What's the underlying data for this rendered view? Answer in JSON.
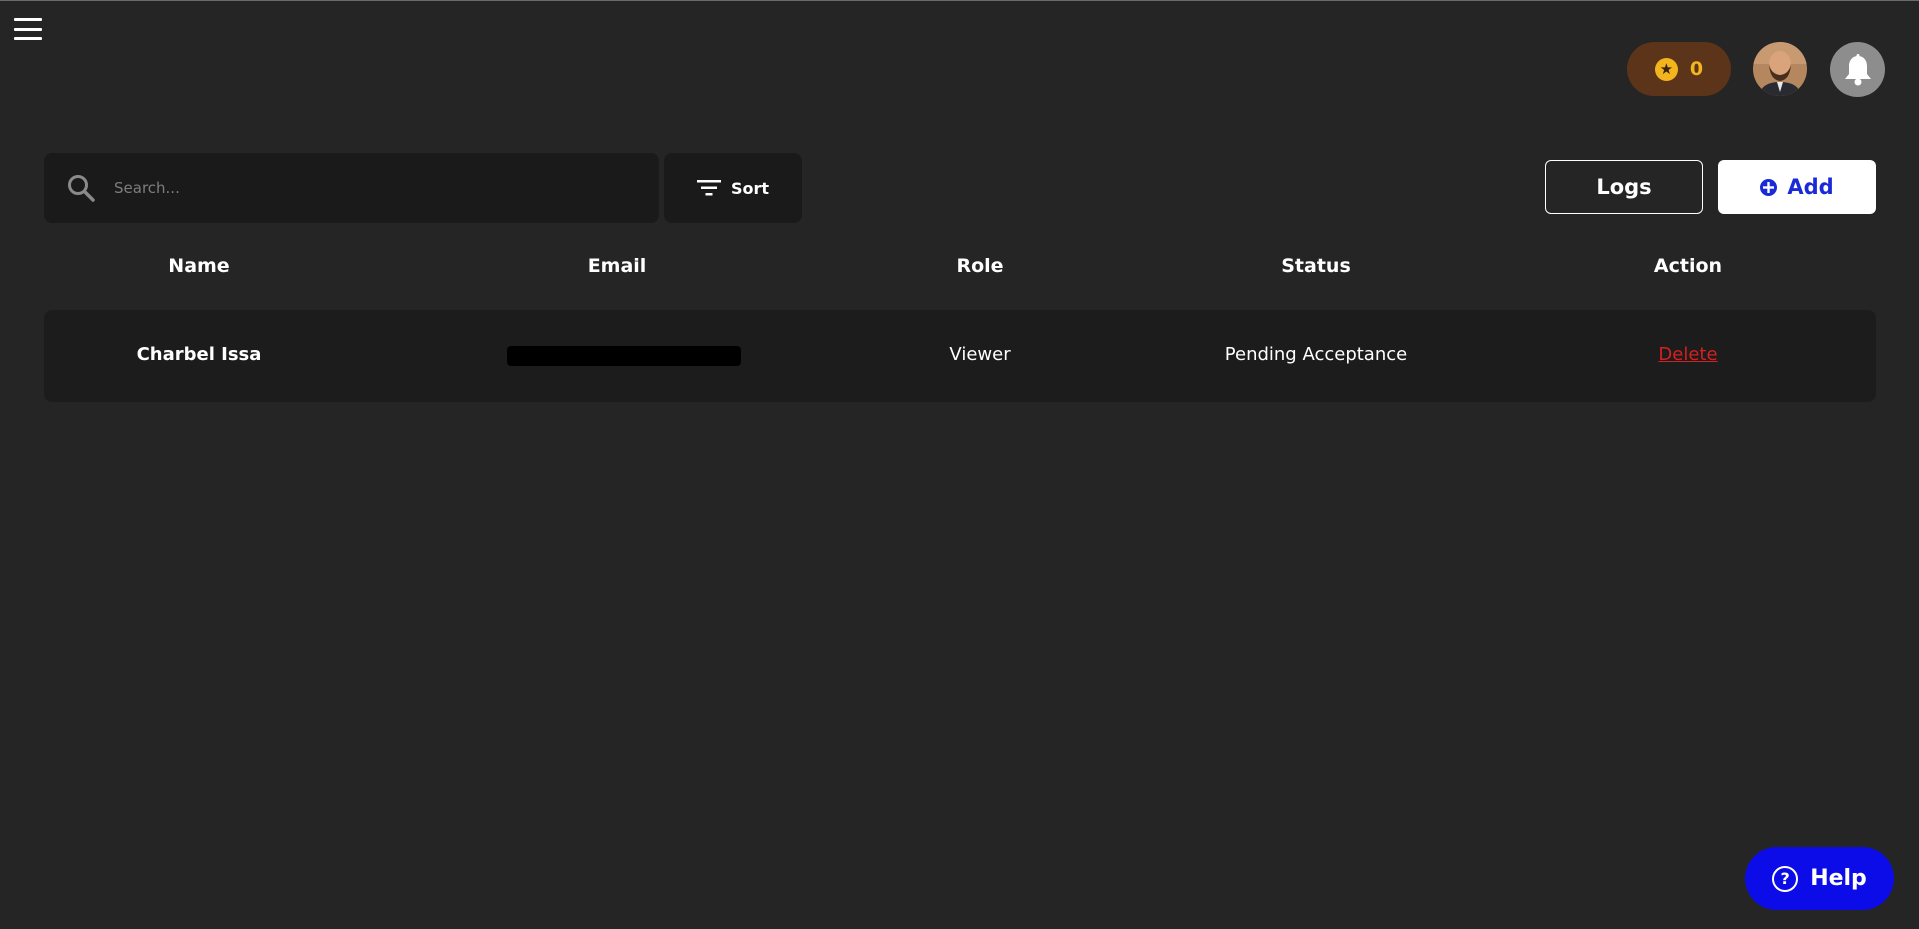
{
  "header": {
    "coins": {
      "count": "0",
      "icon": "star-coin-icon"
    },
    "avatar": {
      "icon": "user-avatar"
    },
    "notifications": {
      "icon": "bell-icon"
    }
  },
  "toolbar": {
    "search_placeholder": "Search...",
    "sort_label": "Sort",
    "logs_label": "Logs",
    "add_label": "Add"
  },
  "table": {
    "columns": [
      "Name",
      "Email",
      "Role",
      "Status",
      "Action"
    ],
    "rows": [
      {
        "name": "Charbel Issa",
        "email": "",
        "role": "Viewer",
        "status": "Pending Acceptance",
        "action": "Delete"
      }
    ]
  },
  "help": {
    "label": "Help"
  },
  "colors": {
    "background": "#252525",
    "panel": "#1a1a1a",
    "accent_blue": "#1a2ad8",
    "help_blue": "#0c0ce8",
    "coin_gold": "#f2b51e",
    "coin_bg": "#5b3419",
    "delete_red": "#d42020"
  }
}
